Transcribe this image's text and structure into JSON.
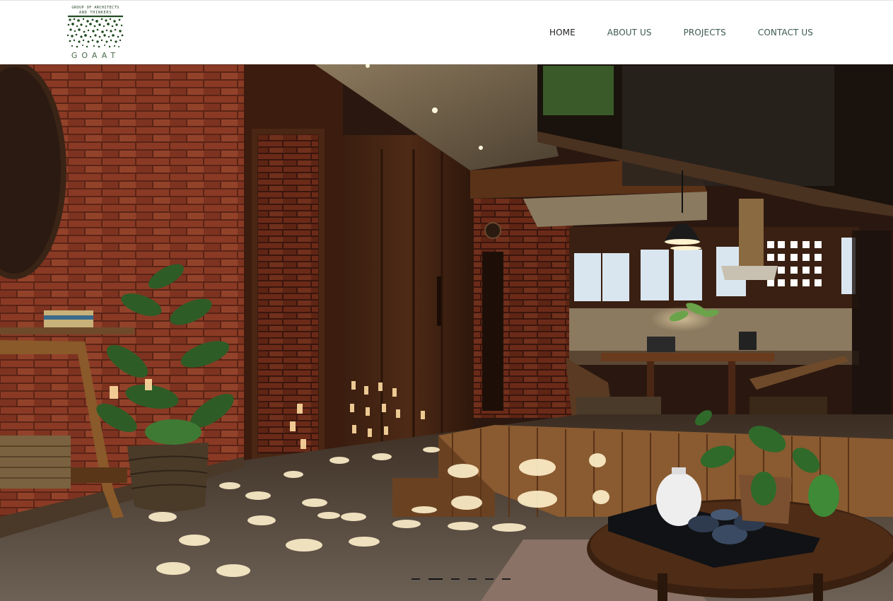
{
  "logo": {
    "line1": "GROUP OF ARCHITECTS",
    "line2": "AND THINKERS",
    "wordmark": "GOAAT"
  },
  "nav": {
    "items": [
      {
        "label": "HOME",
        "active": true
      },
      {
        "label": "ABOUT US",
        "active": false
      },
      {
        "label": "PROJECTS",
        "active": false
      },
      {
        "label": "CONTACT US",
        "active": false
      }
    ]
  },
  "hero": {
    "image_description_icon": "interior-photo",
    "slides_count": 6,
    "active_slide": 2
  },
  "colors": {
    "nav_text": "#3c5b4c",
    "nav_active": "#1f1f1f",
    "logo_green": "#2e5a2e"
  }
}
